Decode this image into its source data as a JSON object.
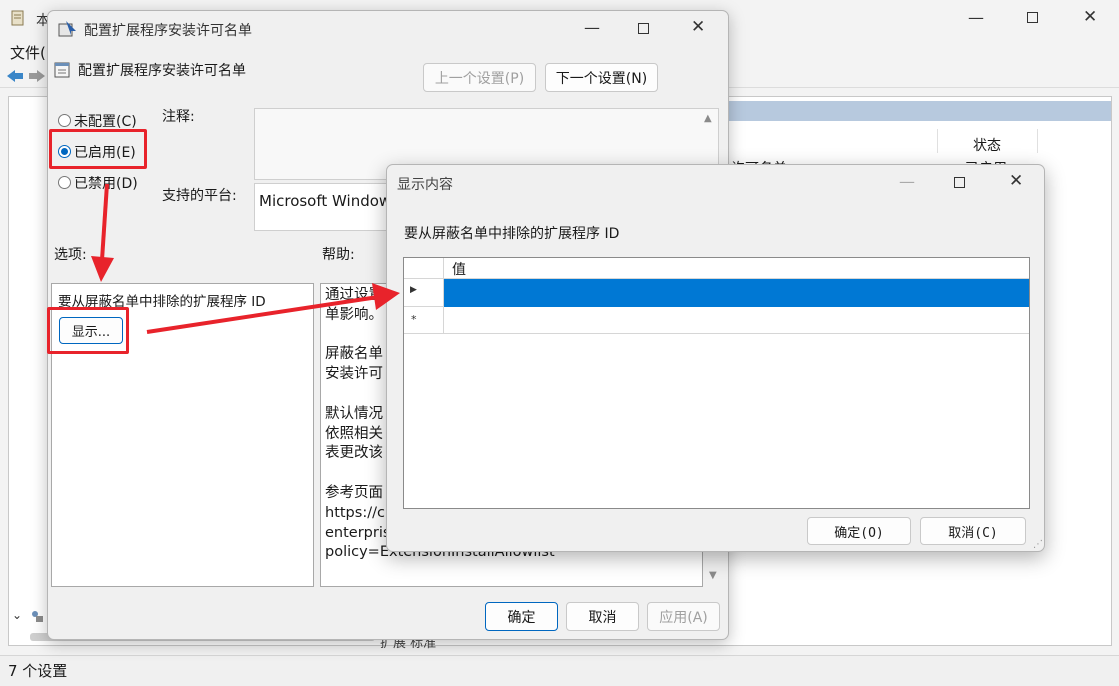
{
  "main_window": {
    "title": "本",
    "menu_file": "文件(",
    "header_status": "状态",
    "row_partial_name": "许可名单",
    "row_partial_status": "已启用",
    "tabs_partial": "扩展 标准",
    "status_bar": "7 个设置"
  },
  "policy_dialog": {
    "title": "配置扩展程序安装许可名单",
    "header_title": "配置扩展程序安装许可名单",
    "prev_button": "上一个设置(P)",
    "next_button": "下一个设置(N)",
    "radio_not_configured": "未配置(C)",
    "radio_enabled": "已启用(E)",
    "radio_disabled": "已禁用(D)",
    "comment_label": "注释:",
    "platform_label": "支持的平台:",
    "platform_value": "Microsoft Window",
    "options_label": "选项:",
    "help_label": "帮助:",
    "options_text": "要从屏蔽名单中排除的扩展程序 ID",
    "show_button": "显示...",
    "help_lines": [
      "通过设置",
      "单影响。",
      "",
      "屏蔽名单",
      "安装许可",
      "",
      "默认情况",
      "依照相关",
      "表更改该",
      "",
      "参考页面",
      "https://c",
      "enterpris",
      "policy=ExtensionInstallAllowlist"
    ],
    "ok_button": "确定",
    "cancel_button": "取消",
    "apply_button": "应用(A)"
  },
  "show_dialog": {
    "title": "显示内容",
    "prompt": "要从屏蔽名单中排除的扩展程序 ID",
    "column_header": "值",
    "new_row_marker": "*",
    "ok_button": "确定(O)",
    "cancel_button": "取消(C)"
  },
  "colors": {
    "highlight": "#e8232b",
    "selection": "#0078d4",
    "accent": "#0067c0"
  }
}
